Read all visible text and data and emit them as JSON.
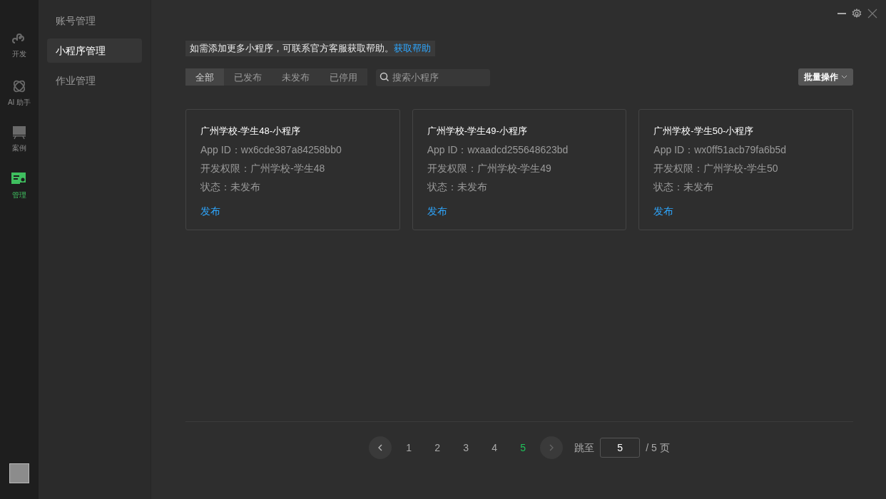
{
  "rail": [
    {
      "kind": "dev",
      "label": "开发",
      "selected": false
    },
    {
      "kind": "ai",
      "label": "AI 助手",
      "selected": false
    },
    {
      "kind": "case",
      "label": "案例",
      "selected": false
    },
    {
      "kind": "manage",
      "label": "管理",
      "selected": true
    }
  ],
  "sidebar": {
    "items": [
      {
        "label": "账号管理",
        "selected": false
      },
      {
        "label": "小程序管理",
        "selected": true
      },
      {
        "label": "作业管理",
        "selected": false
      }
    ]
  },
  "notice": {
    "text": "如需添加更多小程序，可联系官方客服获取帮助。",
    "link": "获取帮助"
  },
  "filters": [
    {
      "label": "全部",
      "selected": true
    },
    {
      "label": "已发布",
      "selected": false
    },
    {
      "label": "未发布",
      "selected": false
    },
    {
      "label": "已停用",
      "selected": false
    }
  ],
  "search": {
    "placeholder": "搜索小程序"
  },
  "batch_button": "批量操作",
  "cards": [
    {
      "title": "广州学校-学生48-小程序",
      "app_id": "App ID：wx6cde387a84258bb0",
      "permission": "开发权限：广州学校-学生48",
      "status": "状态：未发布",
      "action": "发布"
    },
    {
      "title": "广州学校-学生49-小程序",
      "app_id": "App ID：wxaadcd255648623bd",
      "permission": "开发权限：广州学校-学生49",
      "status": "状态：未发布",
      "action": "发布"
    },
    {
      "title": "广州学校-学生50-小程序",
      "app_id": "App ID：wx0ff51acb79fa6b5d",
      "permission": "开发权限：广州学校-学生50",
      "status": "状态：未发布",
      "action": "发布"
    }
  ],
  "pagination": {
    "prev_disabled": false,
    "next_disabled": true,
    "pages": [
      {
        "label": "1",
        "selected": false
      },
      {
        "label": "2",
        "selected": false
      },
      {
        "label": "3",
        "selected": false
      },
      {
        "label": "4",
        "selected": false
      },
      {
        "label": "5",
        "selected": true
      }
    ],
    "jump_label": "跳至",
    "jump_value": "5",
    "total": "/ 5 页"
  }
}
